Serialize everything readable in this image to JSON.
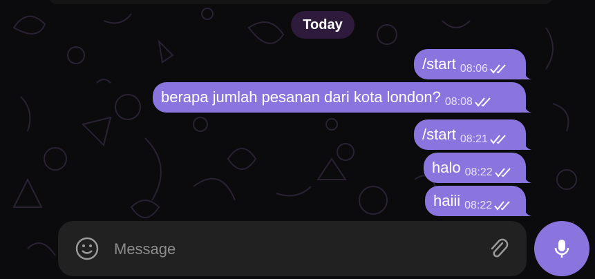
{
  "chat": {
    "date_separator": "Today",
    "messages": [
      {
        "text": "/start",
        "time": "08:06"
      },
      {
        "text": "berapa jumlah pesanan dari kota london?",
        "time": "08:08"
      },
      {
        "text": "/start",
        "time": "08:21"
      },
      {
        "text": "halo",
        "time": "08:22"
      },
      {
        "text": "haiii",
        "time": "08:22"
      }
    ]
  },
  "composer": {
    "placeholder": "Message",
    "emoji_icon": "smile-icon",
    "attach_icon": "paperclip-icon",
    "mic_icon": "microphone-icon"
  },
  "colors": {
    "bubble": "#8a75de",
    "background": "#0b0b0d",
    "date_pill": "#2e1a3b",
    "composer": "#212121"
  }
}
